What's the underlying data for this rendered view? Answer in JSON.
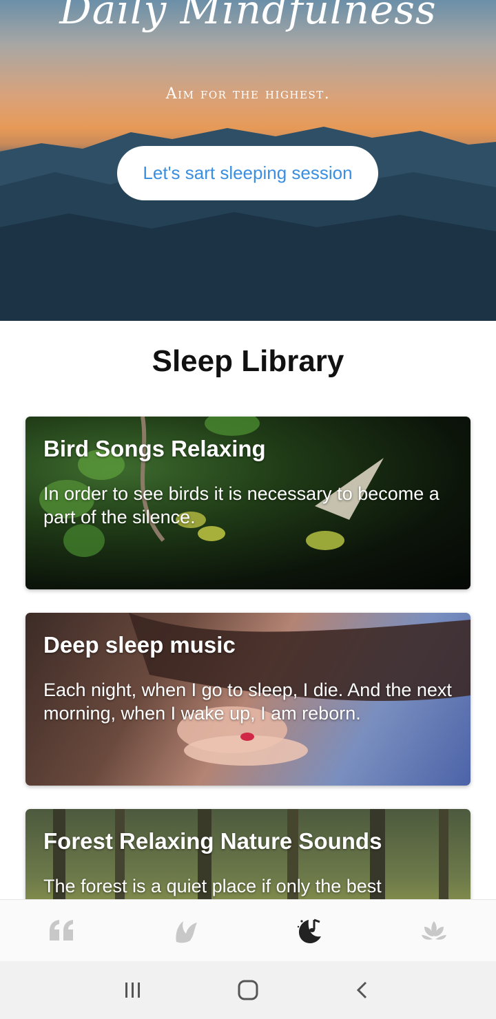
{
  "hero": {
    "title": "Daily Mindfulness",
    "subtitle": "Aim for the highest.",
    "button_label": "Let's sart sleeping session"
  },
  "library": {
    "title": "Sleep Library",
    "cards": [
      {
        "title": "Bird Songs Relaxing",
        "text": "In order to see birds it is necessary to become a part of the silence."
      },
      {
        "title": "Deep sleep music",
        "text": "Each night, when I go to sleep, I die. And the next morning, when I wake up, I am reborn."
      },
      {
        "title": "Forest Relaxing Nature Sounds",
        "text": "The forest is a quiet place if only the best"
      }
    ]
  },
  "tabbar": {
    "tabs": [
      {
        "icon": "quote-icon",
        "active": false
      },
      {
        "icon": "bird-icon",
        "active": false
      },
      {
        "icon": "moon-music-icon",
        "active": true
      },
      {
        "icon": "lotus-icon",
        "active": false
      }
    ]
  },
  "system_nav": {
    "buttons": [
      "recent-apps-icon",
      "home-icon",
      "back-icon"
    ]
  },
  "colors": {
    "accent": "#3a8fe0",
    "tab_active": "#222222",
    "tab_inactive": "#c8c8c8"
  }
}
